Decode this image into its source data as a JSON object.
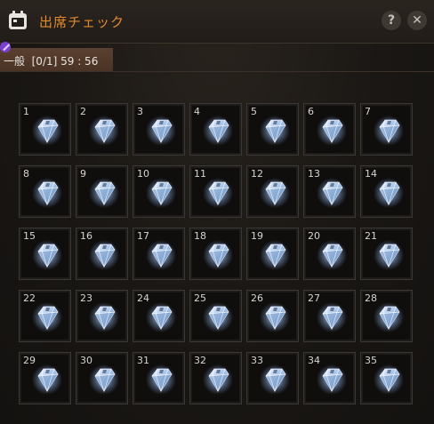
{
  "title": "出席チェック",
  "tab": {
    "label": "一般  [0/1] 59 : 56"
  },
  "buttons": {
    "help": "?",
    "close": "✕"
  },
  "icons": {
    "title": "calendar-icon",
    "reward": "diamond-icon",
    "tab_badge": "feather-icon"
  },
  "colors": {
    "title": "#e08a2e",
    "tab_bg": "#4e3628",
    "cell_border": "#3c3833"
  },
  "days": [
    "1",
    "2",
    "3",
    "4",
    "5",
    "6",
    "7",
    "8",
    "9",
    "10",
    "11",
    "12",
    "13",
    "14",
    "15",
    "16",
    "17",
    "18",
    "19",
    "20",
    "21",
    "22",
    "23",
    "24",
    "25",
    "26",
    "27",
    "28",
    "29",
    "30",
    "31",
    "32",
    "33",
    "34",
    "35"
  ]
}
